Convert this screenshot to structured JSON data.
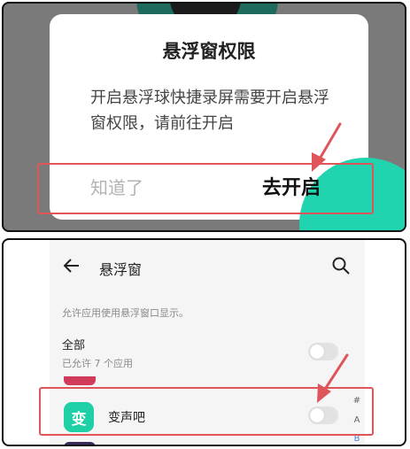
{
  "dialog": {
    "title": "悬浮窗权限",
    "message": "开启悬浮球快捷录屏需要开启悬浮窗权限，请前往开启",
    "dismiss_label": "知道了",
    "confirm_label": "去开启"
  },
  "background": {
    "partial_text": "…………"
  },
  "settings": {
    "title": "悬浮窗",
    "description": "允许应用使用悬浮窗口显示。",
    "all": {
      "label": "全部",
      "sub": "已允许 7 个应用"
    },
    "app": {
      "name": "变声吧",
      "icon_text": "变"
    },
    "index_letters": [
      "#",
      "A",
      "B"
    ]
  },
  "colors": {
    "highlight": "#e0555a",
    "accent": "#20d4b0",
    "overlay": "#7a7a7a"
  }
}
